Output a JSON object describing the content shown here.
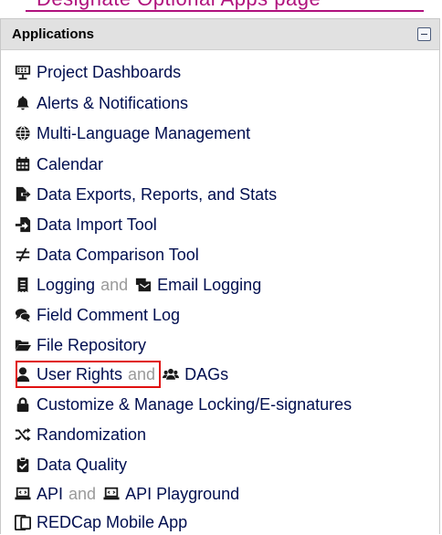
{
  "top_link": {
    "text": "Designate Optional Apps page"
  },
  "panel": {
    "title": "Applications"
  },
  "items": [
    {
      "label": "Project Dashboards",
      "icon": "presentation-icon"
    },
    {
      "label": "Alerts & Notifications",
      "icon": "bell-icon"
    },
    {
      "label": "Multi-Language Management",
      "icon": "globe-icon"
    },
    {
      "label": "Calendar",
      "icon": "calendar-icon"
    },
    {
      "label": "Data Exports, Reports, and Stats",
      "icon": "file-export-icon"
    },
    {
      "label": "Data Import Tool",
      "icon": "file-import-icon"
    },
    {
      "label": "Data Comparison Tool",
      "icon": "not-equal-icon"
    },
    {
      "label": "Logging",
      "icon": "receipt-icon",
      "separator": "and",
      "secondary": {
        "label": "Email Logging",
        "icon": "mail-bulk-icon"
      }
    },
    {
      "label": "Field Comment Log",
      "icon": "comments-icon"
    },
    {
      "label": "File Repository",
      "icon": "folder-open-icon"
    },
    {
      "label": "User Rights",
      "icon": "user-icon",
      "separator": "and",
      "secondary": {
        "label": "DAGs",
        "icon": "users-icon"
      }
    },
    {
      "label": "Customize & Manage Locking/E-signatures",
      "icon": "lock-icon"
    },
    {
      "label": "Randomization",
      "icon": "random-icon"
    },
    {
      "label": "Data Quality",
      "icon": "clipboard-check-icon"
    },
    {
      "label": "API",
      "icon": "laptop-code-icon",
      "separator": "and",
      "secondary": {
        "label": "API Playground",
        "icon": "laptop-code-icon"
      }
    },
    {
      "label": "REDCap Mobile App",
      "icon": "tablet-icon"
    }
  ],
  "colors": {
    "link": "#000e4f",
    "separator": "#9a9a9a",
    "highlight": "#e01010",
    "header_bg": "#e1e1e1"
  }
}
